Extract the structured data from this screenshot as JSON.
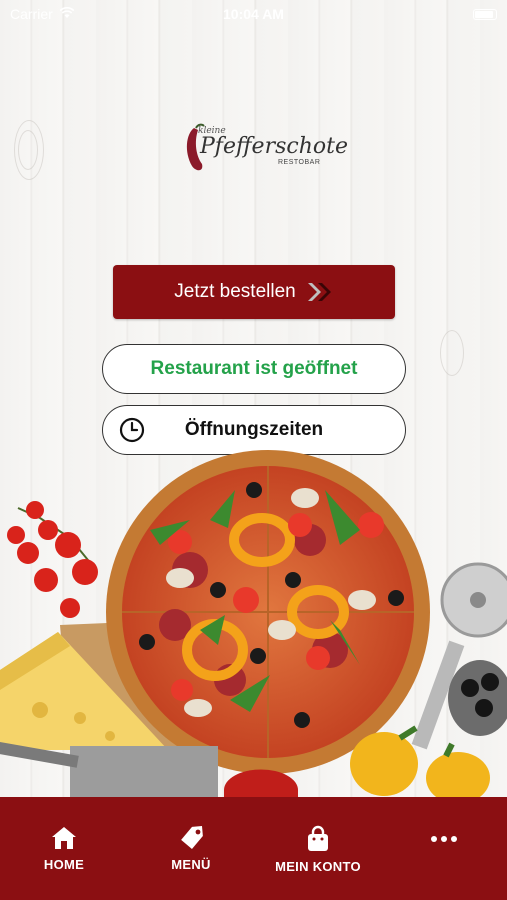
{
  "status_bar": {
    "carrier": "Carrier",
    "time": "10:04 AM"
  },
  "logo": {
    "small_text": "kleine",
    "main_text": "Pfefferschote",
    "sub_text": "RESTOBAR"
  },
  "actions": {
    "order_label": "Jetzt bestellen",
    "open_status": "Restaurant ist geöffnet",
    "hours_label": "Öffnungszeiten"
  },
  "colors": {
    "brand": "#8b0f12",
    "open_status": "#24a24a"
  },
  "bottom_nav": {
    "items": [
      {
        "label": "HOME",
        "icon": "home-icon"
      },
      {
        "label": "MENÜ",
        "icon": "tag-icon"
      },
      {
        "label": "MEIN KONTO",
        "icon": "shopping-bag-icon"
      },
      {
        "label": "",
        "icon": "more-icon"
      }
    ]
  }
}
